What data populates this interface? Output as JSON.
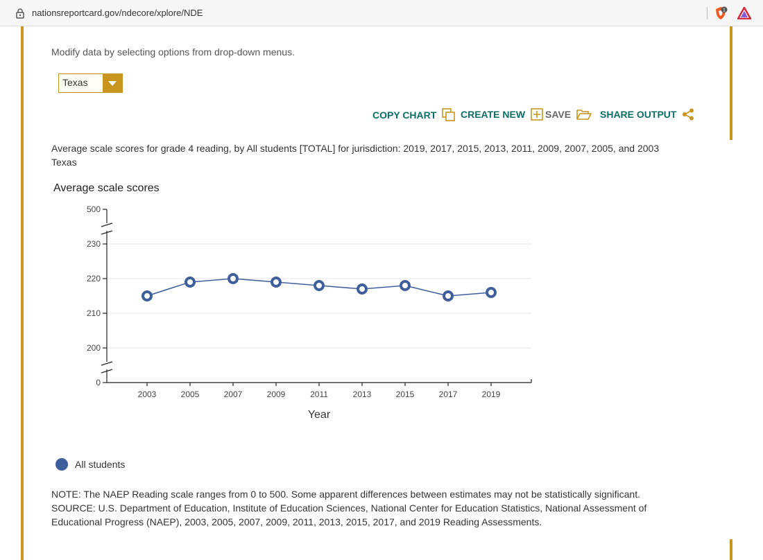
{
  "browser": {
    "url": "nationsreportcard.gov/ndecore/xplore/NDE",
    "rewards_count": "1"
  },
  "page": {
    "instructions": "Modify data by selecting options from drop-down menus.",
    "jurisdiction_select": {
      "value": "Texas"
    },
    "toolbar": {
      "copy_chart": "COPY CHART",
      "create_new": "CREATE NEW",
      "save": "SAVE",
      "share_output": "SHARE OUTPUT"
    },
    "chart_caption_line1": "Average scale scores for grade 4 reading, by All students [TOTAL] for jurisdiction: 2019, 2017, 2015, 2013, 2011, 2009, 2007, 2005, and 2003",
    "chart_caption_line2": "Texas",
    "note": "NOTE: The NAEP Reading scale ranges from 0 to 500. Some apparent differences between estimates may not be statistically significant.",
    "source": "SOURCE: U.S. Department of Education, Institute of Education Sciences, National Center for Education Statistics, National Assessment of Educational Progress (NAEP), 2003, 2005, 2007, 2009, 2011, 2013, 2015, 2017, and 2019 Reading Assessments."
  },
  "colors": {
    "accent_gold": "#c8951e",
    "link_teal": "#0d6e63",
    "series_blue": "#3f5f9c"
  },
  "chart_data": {
    "type": "line",
    "title": "",
    "ylabel": "Average scale scores",
    "xlabel": "Year",
    "x": [
      "2003",
      "2005",
      "2007",
      "2009",
      "2011",
      "2013",
      "2015",
      "2017",
      "2019"
    ],
    "series": [
      {
        "name": "All students",
        "values": [
          215,
          219,
          220,
          219,
          218,
          217,
          218,
          215,
          216
        ]
      }
    ],
    "y_ticks": [
      "0",
      "200",
      "210",
      "220",
      "230",
      "500"
    ],
    "ylim": [
      200,
      230
    ],
    "axis_breaks": true,
    "grid": true,
    "legend": "bottom-left"
  }
}
